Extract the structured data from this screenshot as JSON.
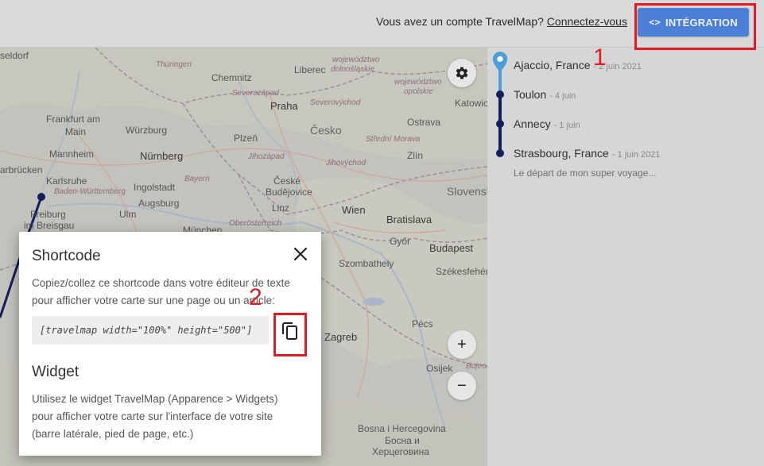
{
  "header": {
    "account_text": "Vous avez un compte TravelMap?",
    "login_link": "Connectez-vous",
    "integration_icon": "<>",
    "integration_label": "INTÉGRATION"
  },
  "map": {
    "labels": [
      {
        "text": "seldorf",
        "kind": "city"
      },
      {
        "text": "Frankfurt am",
        "kind": "city"
      },
      {
        "text": "Main",
        "kind": "city"
      },
      {
        "text": "Mannheim",
        "kind": "city"
      },
      {
        "text": "arbrücken",
        "kind": "city"
      },
      {
        "text": "Karlsruhe",
        "kind": "city"
      },
      {
        "text": "Baden-Württemberg",
        "kind": "region"
      },
      {
        "text": "Freiburg",
        "kind": "city"
      },
      {
        "text": "im Breisgau",
        "kind": "city"
      },
      {
        "text": "Würzburg",
        "kind": "city"
      },
      {
        "text": "Nürnberg",
        "kind": "city"
      },
      {
        "text": "Ingolstadt",
        "kind": "city"
      },
      {
        "text": "Augsburg",
        "kind": "city"
      },
      {
        "text": "Ulm",
        "kind": "city"
      },
      {
        "text": "Bayern",
        "kind": "region"
      },
      {
        "text": "Chemnitz",
        "kind": "city"
      },
      {
        "text": "Thüringen",
        "kind": "region"
      },
      {
        "text": "Liberec",
        "kind": "city"
      },
      {
        "text": "Severozápad",
        "kind": "region"
      },
      {
        "text": "Praha",
        "kind": "capital"
      },
      {
        "text": "Severovýchod",
        "kind": "region"
      },
      {
        "text": "Česko",
        "kind": "country"
      },
      {
        "text": "Plzeň",
        "kind": "city"
      },
      {
        "text": "Jihozápad",
        "kind": "region"
      },
      {
        "text": "České",
        "kind": "city"
      },
      {
        "text": "Budějovice",
        "kind": "city"
      },
      {
        "text": "Jihovýchod",
        "kind": "region"
      },
      {
        "text": "Linz",
        "kind": "city"
      },
      {
        "text": "Oberösterreich",
        "kind": "region"
      },
      {
        "text": "München",
        "kind": "city"
      },
      {
        "text": "Wien",
        "kind": "capital"
      },
      {
        "text": "Bratislava",
        "kind": "capital"
      },
      {
        "text": "Győr",
        "kind": "city"
      },
      {
        "text": "Budapest",
        "kind": "capital"
      },
      {
        "text": "Szombathely",
        "kind": "city"
      },
      {
        "text": "Székesfehérvár",
        "kind": "city"
      },
      {
        "text": "Zagreb",
        "kind": "capital"
      },
      {
        "text": "Pécs",
        "kind": "city"
      },
      {
        "text": "Osijek",
        "kind": "city"
      },
      {
        "text": "Bojeod",
        "kind": "region"
      },
      {
        "text": "Ostrava",
        "kind": "city"
      },
      {
        "text": "Katowic",
        "kind": "city"
      },
      {
        "text": "Zlín",
        "kind": "city"
      },
      {
        "text": "Střední Morava",
        "kind": "region"
      },
      {
        "text": "Slovensk",
        "kind": "country"
      },
      {
        "text": "województwo",
        "kind": "region"
      },
      {
        "text": "dolnośląskie",
        "kind": "region"
      },
      {
        "text": "województwo",
        "kind": "region"
      },
      {
        "text": "opolskie",
        "kind": "region"
      },
      {
        "text": "Bosna i Hercegovina",
        "kind": "city"
      },
      {
        "text": "Босна и",
        "kind": "city"
      },
      {
        "text": "Херцеговина",
        "kind": "city"
      }
    ]
  },
  "sidebar": {
    "stops": [
      {
        "name": "Ajaccio, France",
        "date": "- 2 juin 2021"
      },
      {
        "name": "Toulon",
        "date": "- 4 juin"
      },
      {
        "name": "Annecy",
        "date": "- 1 juin"
      },
      {
        "name": "Strasbourg, France",
        "date": "- 1 juin 2021"
      }
    ],
    "last_description": "Le départ de mon super voyage..."
  },
  "dialog": {
    "title": "Shortcode",
    "intro": "Copiez/collez ce shortcode dans votre éditeur de texte pour afficher votre carte sur une page ou un article:",
    "shortcode": "[travelmap width=\"100%\" height=\"500\"]",
    "widget_title": "Widget",
    "widget_text": "Utilisez le widget TravelMap (Apparence > Widgets) pour afficher votre carte sur l'interface de votre site (barre latérale, pied de page, etc.)"
  },
  "annotations": {
    "step1": "1",
    "step2": "2"
  },
  "colors": {
    "accent": "#4c7fd6",
    "route": "#141e5a",
    "annotation": "#e21b24",
    "pin": "#4a9fd8"
  },
  "map_controls": {
    "zoom_in": "+",
    "zoom_out": "−"
  }
}
